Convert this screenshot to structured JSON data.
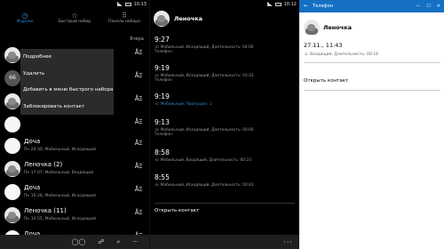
{
  "status": {
    "left_time": "10:13",
    "mid_time": "10:12"
  },
  "panel1": {
    "tabs": [
      {
        "label": "Журнал",
        "icon": "history-icon",
        "glyph": "◷",
        "active": true
      },
      {
        "label": "Быстрый набор",
        "icon": "star-icon",
        "glyph": "☆",
        "active": false
      },
      {
        "label": "Панель набора",
        "icon": "keypad-icon",
        "glyph": "⠿",
        "active": false
      }
    ],
    "section_label": "Вчера",
    "context_menu": [
      "Подробнее",
      "Удалить",
      "Добавить в меню быстрого набора",
      "Заблокировать контакт"
    ],
    "rows": [
      {
        "name": "",
        "meta": "",
        "avatar": "bird"
      },
      {
        "name": "",
        "meta": "",
        "avatar": "initials",
        "initials": "66"
      },
      {
        "name": "",
        "meta": "",
        "avatar": "bird"
      },
      {
        "name": "",
        "meta": "",
        "avatar": "white"
      },
      {
        "name": "Доча",
        "meta": "Пн 20:30, Мобильный, Исходящий",
        "avatar": "white"
      },
      {
        "name": "Леночка (2)",
        "meta": "Пн 17:07, Мобильный, Входящий",
        "avatar": "bird"
      },
      {
        "name": "Доча",
        "meta": "Пн 16:28, Мобильный, Исходящий",
        "avatar": "white"
      },
      {
        "name": "Леночка (11)",
        "meta": "Пн 14:55, Мобильный, Исходящий",
        "avatar": "bird"
      },
      {
        "name": "Доча",
        "meta": "Сб 12:11, Мобильный, Исходящий",
        "avatar": "white"
      }
    ],
    "appbar": [
      "◯◯",
      "☍",
      "⌕",
      "···"
    ]
  },
  "panel2": {
    "title": "Леночка",
    "calls": [
      {
        "time": "9:27",
        "detail": "☏ Мобильный, Исходящий, Длительность: 04:00",
        "src": "Телефон",
        "missed": false
      },
      {
        "time": "9:19",
        "detail": "☏ Мобильный, Исходящий, Длительность: 03:33",
        "src": "Телефон",
        "missed": false
      },
      {
        "time": "9:19",
        "detail": "☏ Мобильный, Пропущен: 1",
        "src": "",
        "missed": true
      },
      {
        "time": "9:13",
        "detail": "☏ Мобильный, Исходящий, Длительность: 00:00",
        "src": "Телефон",
        "missed": false
      },
      {
        "time": "8:58",
        "detail": "☏ Мобильный, Входящий, Длительность: 00:23",
        "src": "",
        "missed": false
      },
      {
        "time": "8:55",
        "detail": "☏ Мобильный, Исходящий, Длительность: 00:43",
        "src": "",
        "missed": false
      }
    ],
    "open_contact": "Открыть контакт",
    "appbar": "···"
  },
  "panel3": {
    "app_title": "Телефон",
    "contact_name": "Леночка",
    "time": "27.11., 11:43",
    "detail": "☏ Входящий, Длительность: 00:16",
    "open_contact": "Открыть контакт",
    "window_controls": [
      "—",
      "☐",
      "✕"
    ]
  }
}
